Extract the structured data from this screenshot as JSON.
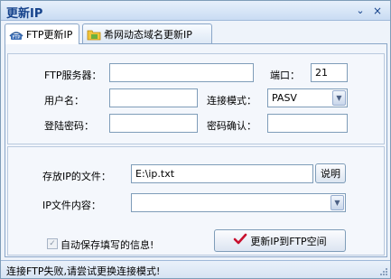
{
  "window": {
    "title": "更新IP",
    "minimize_glyph": "⌄",
    "close_glyph": "×"
  },
  "tabs": [
    {
      "label": "FTP更新IP",
      "icon": "ftp-icon",
      "active": true
    },
    {
      "label": "希网动态域名更新IP",
      "icon": "folder-icon",
      "active": false
    }
  ],
  "ftp": {
    "server_label": "FTP服务器：",
    "server_value": "",
    "port_label": "端口：",
    "port_value": "21",
    "username_label": "用户名：",
    "username_value": "",
    "mode_label": "连接模式：",
    "mode_value": "PASV",
    "password_label": "登陆密码：",
    "password_value": "",
    "confirm_label": "密码确认：",
    "confirm_value": ""
  },
  "file": {
    "path_label": "存放IP的文件：",
    "path_value": "E:\\ip.txt",
    "help_button": "说明",
    "content_label": "IP文件内容：",
    "content_value": ""
  },
  "options": {
    "autosave_label": "自动保存填写的信息!",
    "autosave_checked": true,
    "update_button": "更新IP到FTP空间"
  },
  "status": {
    "text": "连接FTP失败,请尝试更换连接模式!"
  },
  "colors": {
    "title_text": "#15428b",
    "check_mark": "#c8102e",
    "border": "#7f9db9"
  }
}
